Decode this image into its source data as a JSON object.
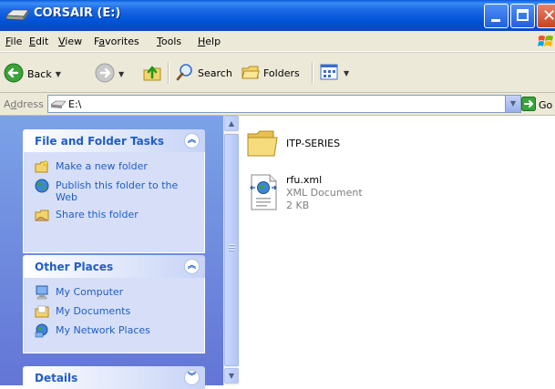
{
  "window": {
    "title": "CORSAIR (E:)"
  },
  "menu": {
    "items": [
      {
        "key": "F",
        "rest": "ile"
      },
      {
        "key": "E",
        "rest": "dit"
      },
      {
        "key": "V",
        "rest": "iew"
      },
      {
        "key": "a",
        "pre": "F",
        "rest": "vorites"
      },
      {
        "key": "T",
        "rest": "ools"
      },
      {
        "key": "H",
        "rest": "elp"
      }
    ]
  },
  "toolbar": {
    "back_label": "Back",
    "search_label": "Search",
    "folders_label": "Folders"
  },
  "address": {
    "label": "Address",
    "label_key": "d",
    "value": "E:\\",
    "go_label": "Go"
  },
  "taskpane": {
    "file_tasks": {
      "title": "File and Folder Tasks",
      "items": [
        {
          "label": "Make a new folder",
          "icon": "new-folder-icon"
        },
        {
          "label": "Publish this folder to the Web",
          "icon": "globe-publish-icon"
        },
        {
          "label": "Share this folder",
          "icon": "share-folder-icon"
        }
      ]
    },
    "other_places": {
      "title": "Other Places",
      "items": [
        {
          "label": "My Computer",
          "icon": "my-computer-icon"
        },
        {
          "label": "My Documents",
          "icon": "my-documents-icon"
        },
        {
          "label": "My Network Places",
          "icon": "network-places-icon"
        }
      ]
    },
    "details": {
      "title": "Details"
    }
  },
  "files": [
    {
      "name": "ITP-SERIES",
      "type": "folder"
    },
    {
      "name": "rfu.xml",
      "type_label": "XML Document",
      "size": "2 KB"
    }
  ],
  "colors": {
    "titlebar": "#0052d6",
    "taskpane_bg": "#7ba2e7",
    "link": "#215dc6",
    "close_button": "#c8431f"
  }
}
